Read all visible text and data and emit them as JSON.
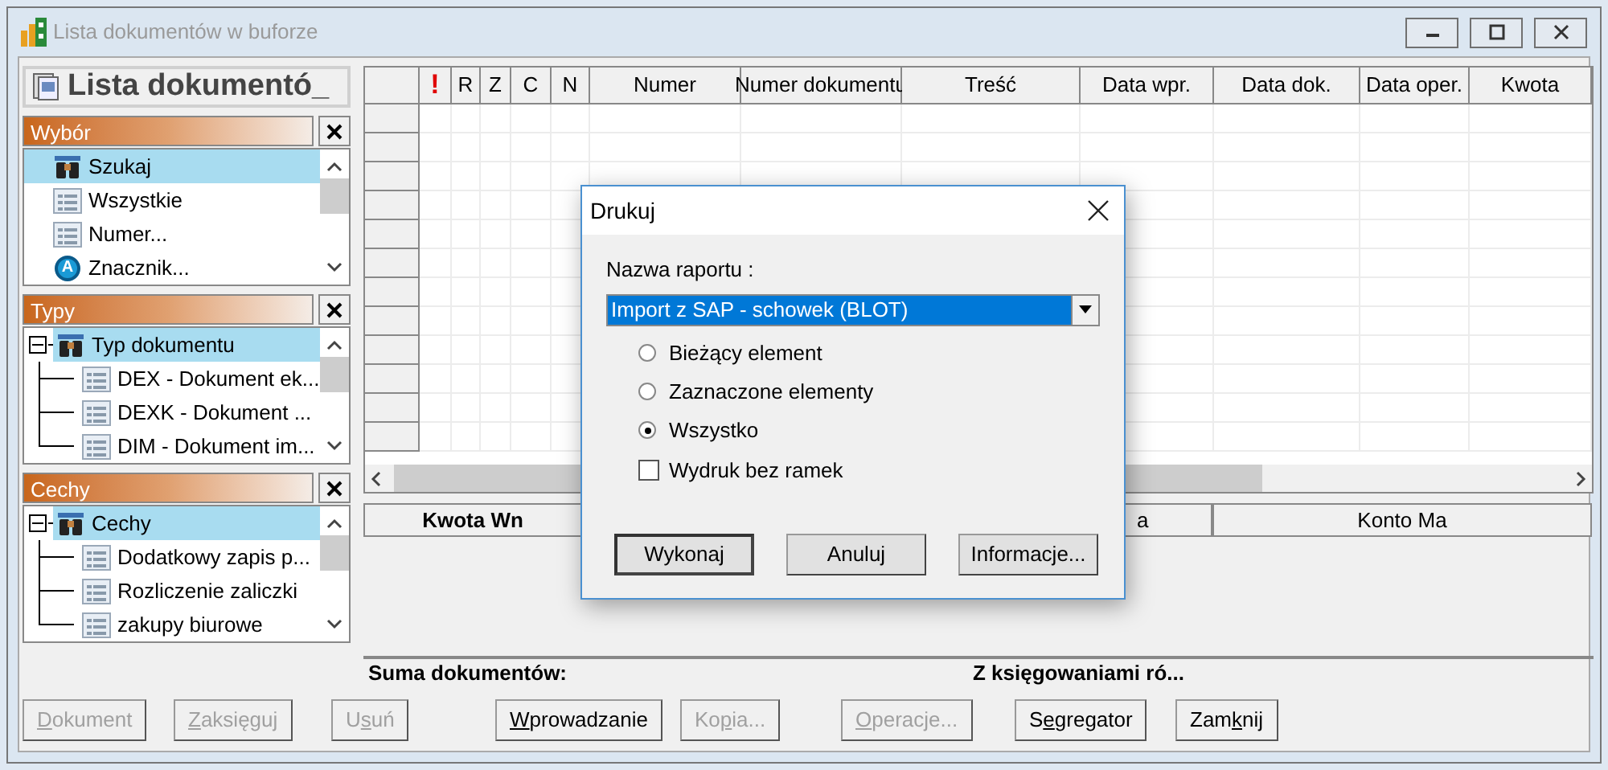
{
  "window": {
    "title": "Lista dokumentów w buforze"
  },
  "left_panel": {
    "title": "Lista dokumentó_",
    "sections": [
      {
        "title": "Wybór",
        "items": [
          {
            "label": "Szukaj",
            "kind": "search",
            "selected": true
          },
          {
            "label": "Wszystkie",
            "kind": "list",
            "selected": false
          },
          {
            "label": "Numer...",
            "kind": "list",
            "selected": false
          },
          {
            "label": "Znacznik...",
            "kind": "marker",
            "badge": "A",
            "selected": false
          }
        ]
      },
      {
        "title": "Typy",
        "items": [
          {
            "label": "Typ dokumentu",
            "kind": "search",
            "selected": true,
            "expanded": true,
            "children": [
              {
                "label": "DEX - Dokument ek...",
                "kind": "list",
                "selected": false
              },
              {
                "label": "DEXK - Dokument ...",
                "kind": "list",
                "selected": false
              },
              {
                "label": "DIM - Dokument im...",
                "kind": "list",
                "selected": false
              }
            ]
          }
        ]
      },
      {
        "title": "Cechy",
        "items": [
          {
            "label": "Cechy",
            "kind": "search",
            "selected": true,
            "expanded": true,
            "children": [
              {
                "label": "Dodatkowy zapis p...",
                "kind": "list",
                "selected": false
              },
              {
                "label": "Rozliczenie zaliczki",
                "kind": "list",
                "selected": false
              },
              {
                "label": "zakupy biurowe",
                "kind": "list",
                "selected": false
              }
            ]
          }
        ]
      }
    ]
  },
  "table": {
    "columns": [
      {
        "label": "!",
        "kind": "alert"
      },
      {
        "label": "R"
      },
      {
        "label": "Z"
      },
      {
        "label": "C"
      },
      {
        "label": "N"
      },
      {
        "label": "Numer"
      },
      {
        "label": "Numer dokumentu"
      },
      {
        "label": "Treść"
      },
      {
        "label": "Data wpr."
      },
      {
        "label": "Data dok."
      },
      {
        "label": "Data oper."
      },
      {
        "label": "Kwota"
      }
    ]
  },
  "postings_table": {
    "columns": [
      "Kwota Wn",
      "a",
      "Konto Ma"
    ]
  },
  "summary": {
    "documents": "Suma dokumentów:",
    "postings": "Z księgowaniami ró..."
  },
  "buttons": [
    {
      "key": "D",
      "after": "okument",
      "disabled": true
    },
    {
      "key": "Z",
      "after": "aksięguj",
      "disabled": true
    },
    {
      "before": "U",
      "key": "s",
      "after": "uń",
      "disabled": true
    },
    {
      "key": "W",
      "after": "prowadzanie",
      "disabled": false
    },
    {
      "before": "Ko",
      "key": "p",
      "after": "ia...",
      "disabled": true
    },
    {
      "key": "O",
      "after": "peracje...",
      "disabled": true
    },
    {
      "before": "S",
      "key": "e",
      "after": "gregator",
      "disabled": false
    },
    {
      "before": "Zam",
      "key": "k",
      "after": "nij",
      "disabled": false
    }
  ],
  "dialog": {
    "title": "Drukuj",
    "report_label": "Nazwa raportu :",
    "report_value": "Import z SAP - schowek (BLOT)",
    "options": [
      {
        "label": "Bieżący element",
        "selected": false
      },
      {
        "label": "Zaznaczone elementy",
        "selected": false
      },
      {
        "label": "Wszystko",
        "selected": true
      }
    ],
    "checkbox": {
      "label": "Wydruk bez ramek",
      "checked": false
    },
    "buttons": [
      "Wykonaj",
      "Anuluj",
      "Informacje..."
    ]
  }
}
